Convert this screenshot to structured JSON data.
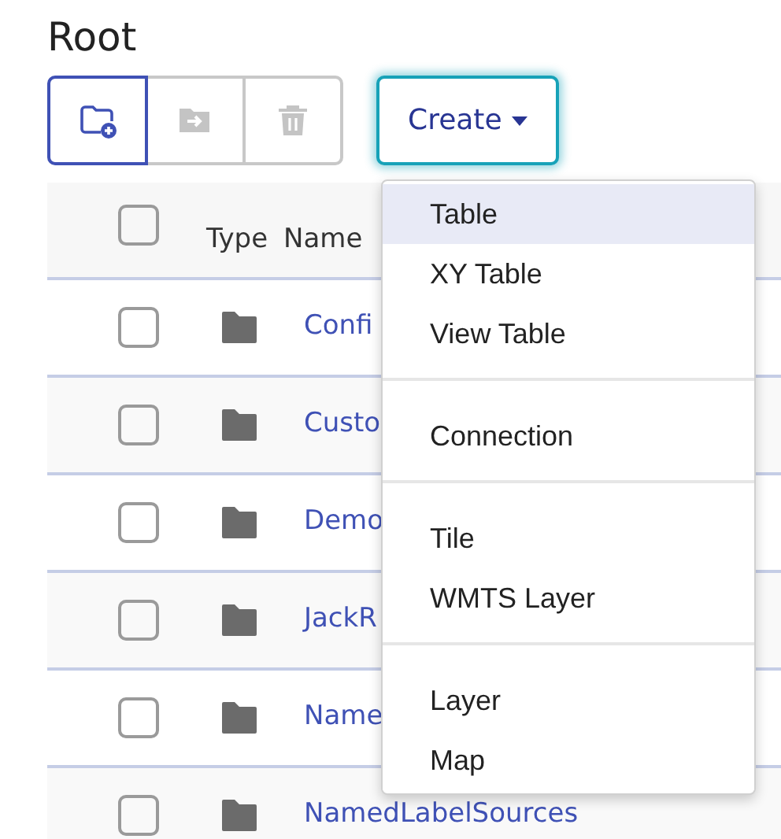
{
  "title": "Root",
  "toolbar": [
    {
      "kind": "new-folder",
      "disabled": false
    },
    {
      "kind": "move",
      "disabled": true
    },
    {
      "kind": "delete",
      "disabled": true
    }
  ],
  "create": {
    "label": "Create",
    "expanded": true
  },
  "menu": [
    [
      {
        "label": "Table",
        "selected": true
      },
      {
        "label": "XY Table",
        "selected": false
      },
      {
        "label": "View Table",
        "selected": false
      }
    ],
    [
      {
        "label": "Connection",
        "selected": false
      }
    ],
    [
      {
        "label": "Tile",
        "selected": false
      },
      {
        "label": "WMTS Layer",
        "selected": false
      }
    ],
    [
      {
        "label": "Layer",
        "selected": false
      },
      {
        "label": "Map",
        "selected": false
      }
    ]
  ],
  "table": {
    "select_all": {
      "checked": false
    },
    "columns": [
      "Type",
      "Name"
    ],
    "rows": [
      {
        "checked": false,
        "name": "Confi"
      },
      {
        "checked": false,
        "name": "Custo"
      },
      {
        "checked": false,
        "name": "Demo"
      },
      {
        "checked": false,
        "name": "JackR"
      },
      {
        "checked": false,
        "name": "Name"
      },
      {
        "checked": false,
        "name": "NamedLabelSources"
      }
    ]
  }
}
